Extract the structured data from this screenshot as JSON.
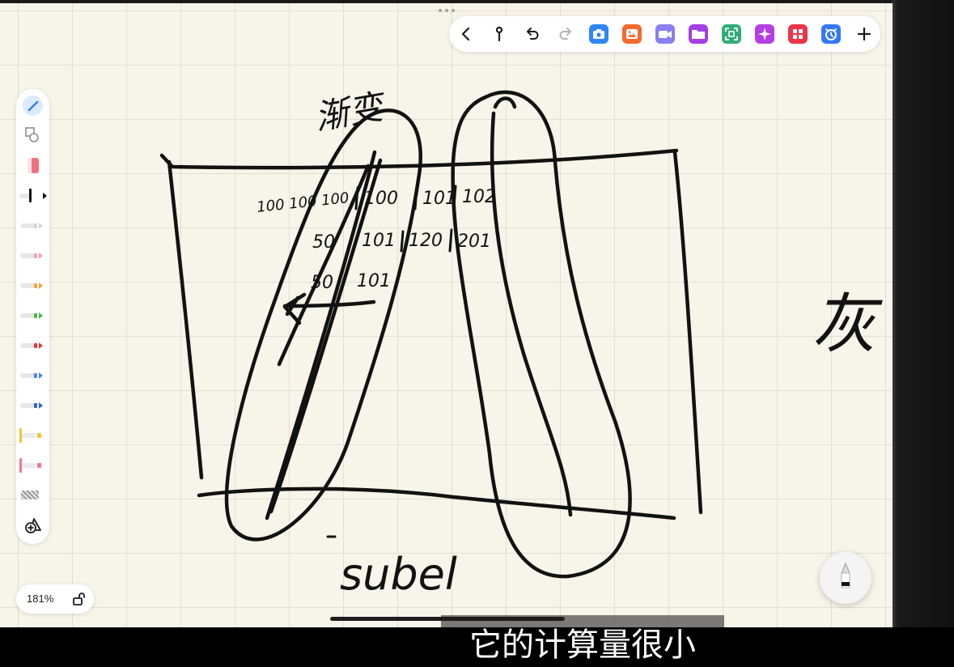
{
  "toolbar": {
    "items": [
      {
        "icon": "chevron-left-icon",
        "color": "#1c1c1e"
      },
      {
        "icon": "pin-icon",
        "color": "#1c1c1e"
      },
      {
        "icon": "undo-icon",
        "color": "#1c1c1e"
      },
      {
        "icon": "redo-icon",
        "color": "#b5b5b5"
      },
      {
        "icon": "camera-icon",
        "color": "#2f86f6"
      },
      {
        "icon": "image-icon",
        "color": "#f46a2c"
      },
      {
        "icon": "video-icon",
        "color": "#8b7ff2"
      },
      {
        "icon": "folder-icon",
        "color": "#a33de6"
      },
      {
        "icon": "scan-icon",
        "color": "#2fad78"
      },
      {
        "icon": "sparkle-icon",
        "color": "#b63de4"
      },
      {
        "icon": "grid-icon",
        "color": "#e8354c"
      },
      {
        "icon": "alarm-icon",
        "color": "#3478f6"
      },
      {
        "icon": "add-icon",
        "color": "#1c1c1e"
      }
    ]
  },
  "tool_palette": {
    "tools": [
      {
        "icon": "pen-tool-icon",
        "color": "#2f7cf6"
      },
      {
        "icon": "shapes-icon",
        "color": "#8e8e93"
      },
      {
        "icon": "eraser-icon",
        "color": "#f0707f"
      },
      {
        "icon": "pen-icon",
        "color": "#111111",
        "selected": true
      },
      {
        "icon": "pen-icon",
        "color": "#d3d3d7"
      },
      {
        "icon": "pen-icon",
        "color": "#f5a3b6"
      },
      {
        "icon": "pen-icon",
        "color": "#f2a33a"
      },
      {
        "icon": "pen-icon",
        "color": "#4cb84a"
      },
      {
        "icon": "pen-icon",
        "color": "#e23a3a"
      },
      {
        "icon": "pen-icon",
        "color": "#4f86ec"
      },
      {
        "icon": "pen-icon",
        "color": "#2f62da"
      },
      {
        "icon": "highlighter-icon",
        "color": "#f3c531"
      },
      {
        "icon": "highlighter-icon",
        "color": "#f1778a"
      },
      {
        "icon": "texture-icon",
        "color": "#9a9a9a"
      },
      {
        "icon": "add-color-icon",
        "color": "#1c1c1e"
      }
    ]
  },
  "zoom": {
    "level": "181%",
    "lock_icon": "unlock-icon"
  },
  "pen_button": {
    "icon": "pen-icon"
  },
  "canvas": {
    "background": "#f7f4ea",
    "ink_color": "#121212",
    "notes": {
      "title": "渐变",
      "side_note": "灰",
      "bottom_label": "subel",
      "row1_left": "100 100 100",
      "row1": [
        "100",
        "101",
        "102"
      ],
      "row2": [
        "50",
        "101",
        "120",
        "201"
      ],
      "row3": [
        "50",
        "101"
      ]
    }
  },
  "subtitle": {
    "text": "它的计算量很小"
  }
}
